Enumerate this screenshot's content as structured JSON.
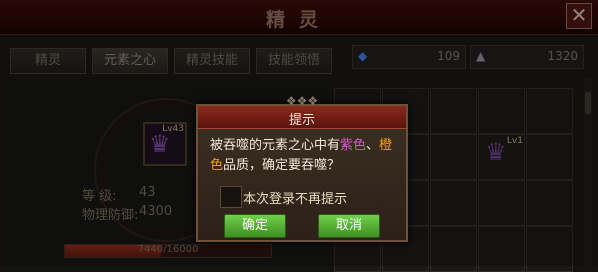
{
  "window": {
    "title": "精灵",
    "close_symbol": "✕"
  },
  "tabs": [
    {
      "label": "精灵"
    },
    {
      "label": "元素之心"
    },
    {
      "label": "精灵技能"
    },
    {
      "label": "技能领悟"
    }
  ],
  "resources": [
    {
      "icon": "diamond-icon",
      "glyph": "◆",
      "value": "109"
    },
    {
      "icon": "crystal-icon",
      "glyph": "▲",
      "value": "1320"
    }
  ],
  "element_slot": {
    "level": "Lv43",
    "icon": "element-heart-icon",
    "glyph": "♛"
  },
  "stats": {
    "level_label": "等    级:",
    "level_value": "43",
    "defense_label": "物理防御:",
    "defense_value": "4300"
  },
  "exp": {
    "text": "7440/16000",
    "fraction": 0.465
  },
  "inventory_item": {
    "level": "Lv1",
    "icon": "element-heart-icon",
    "glyph": "♛"
  },
  "dialog": {
    "title": "提示",
    "msg_part1": "被吞噬的元素之心中有",
    "msg_purple": "紫色",
    "msg_sep": "、",
    "msg_orange": "橙",
    "msg_orange2": "色",
    "msg_part2": "品质，确定要吞噬？",
    "checkbox_label": "本次登录不再提示",
    "checkbox_checked": false,
    "confirm_label": "确定",
    "cancel_label": "取消"
  },
  "colors": {
    "purple_quality": "#d75ad0",
    "orange_quality": "#f0a020",
    "button_green": "#5cbf3a",
    "header_red": "#7a2216"
  }
}
